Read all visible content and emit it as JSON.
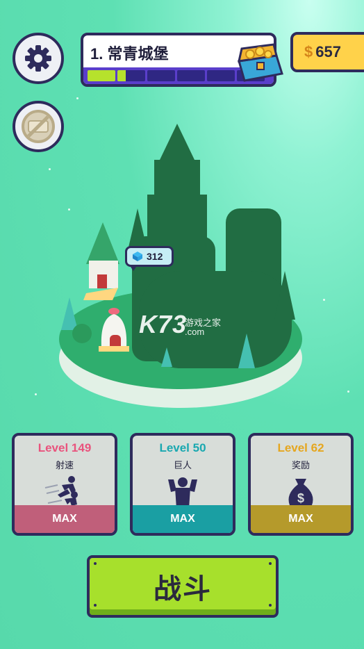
{
  "header": {
    "level_title": "1. 常青城堡",
    "progress_segments_total": 6,
    "progress_filled_fraction": 0.28,
    "coins": "657",
    "currency_symbol": "$"
  },
  "island": {
    "gem_bubble_value": "312"
  },
  "watermark": {
    "logo": "K73",
    "site_name": "游戏之家",
    "domain": ".com"
  },
  "upgrades": [
    {
      "level": "Level 149",
      "name": "射速",
      "action": "MAX",
      "icon": "running-men-icon",
      "level_color": "#e9537d",
      "footer_color": "#c05f7a"
    },
    {
      "level": "Level 50",
      "name": "巨人",
      "action": "MAX",
      "icon": "muscle-man-icon",
      "level_color": "#19a8b0",
      "footer_color": "#1a9fa3"
    },
    {
      "level": "Level 62",
      "name": "奖励",
      "action": "MAX",
      "icon": "money-bag-icon",
      "level_color": "#e5a61f",
      "footer_color": "#b59a2b"
    }
  ],
  "fight_button": {
    "label": "战斗"
  }
}
